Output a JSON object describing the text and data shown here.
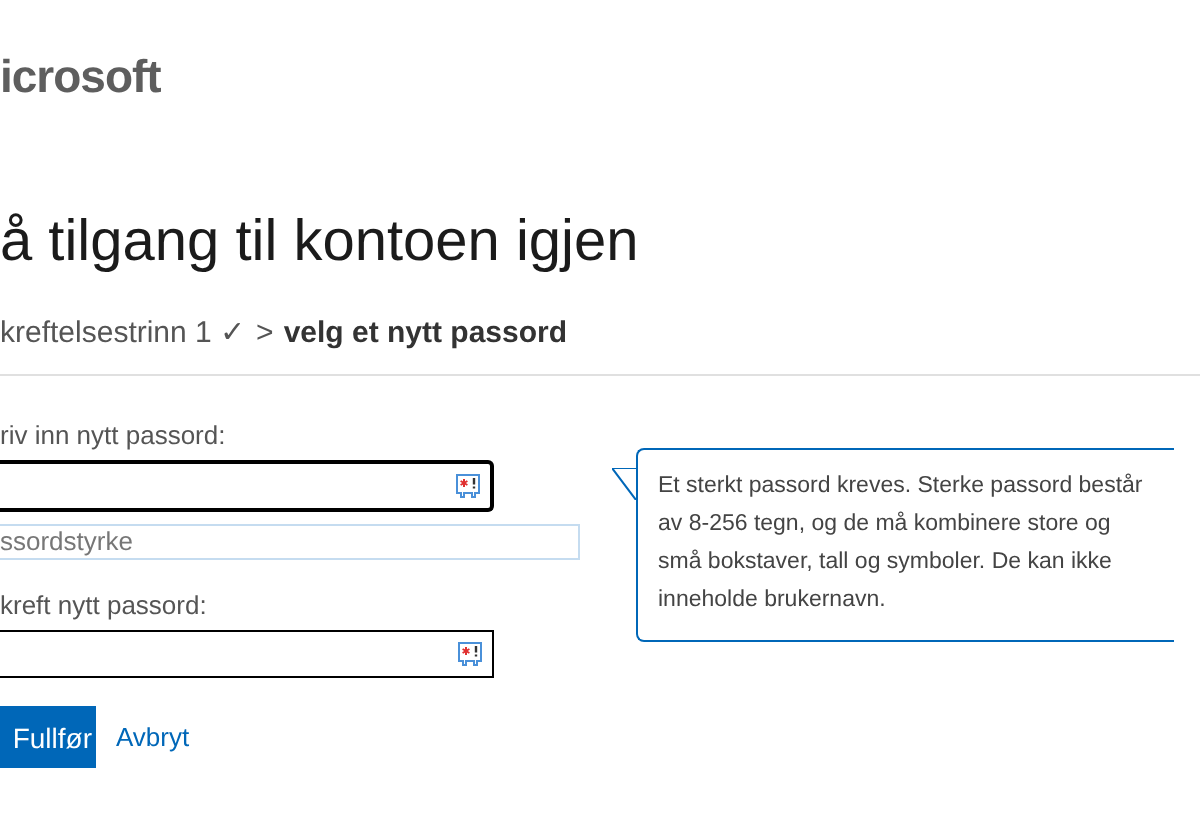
{
  "logo": "icrosoft",
  "heading": "å tilgang til kontoen igjen",
  "breadcrumb": {
    "done_step": "kreftelsestrinn 1 ✓",
    "separator": ">",
    "current_step": "velg et nytt passord"
  },
  "fields": [
    {
      "label": "riv inn nytt passord:",
      "focused": true
    },
    {
      "label": "kreft nytt passord:",
      "focused": false
    }
  ],
  "strength": {
    "label": "ssordstyrke"
  },
  "tooltip": "Et sterkt passord kreves. Sterke passord består av 8-256 tegn, og de må kombinere store og små bokstaver, tall og symboler. De kan ikke inneholde brukernavn.",
  "buttons": {
    "submit": "Fullfør",
    "cancel": "Avbryt"
  }
}
